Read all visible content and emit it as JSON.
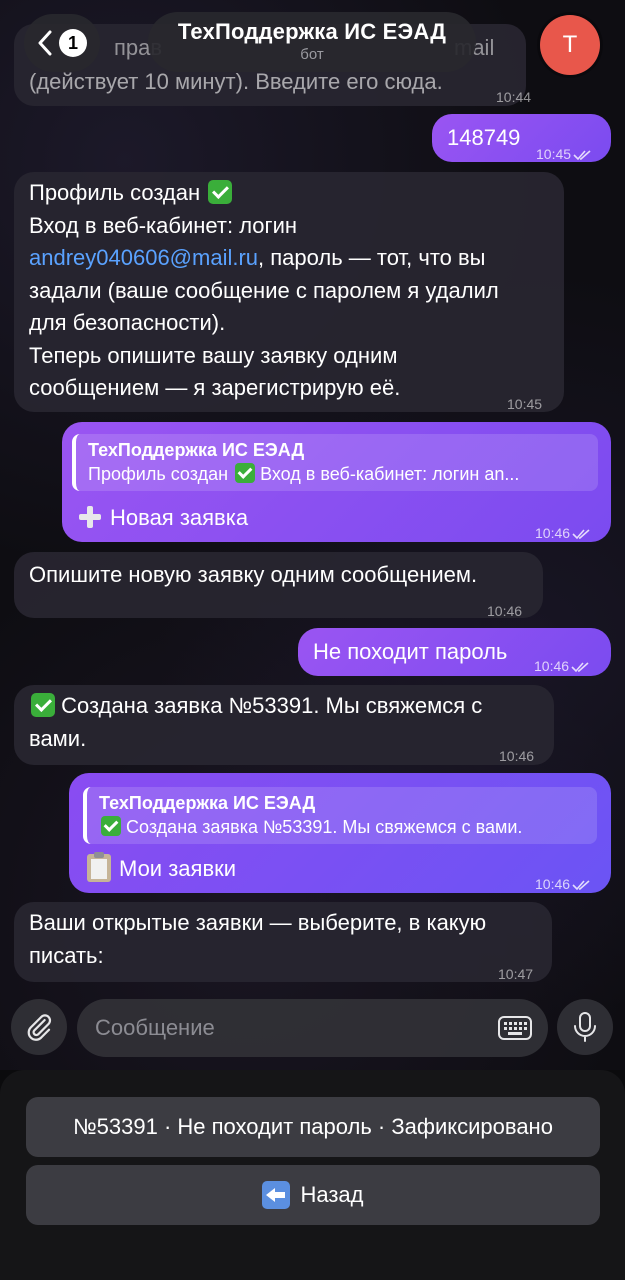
{
  "header": {
    "back_badge": "1",
    "title": "ТехПоддержка ИС ЕЭАД",
    "subtitle": "бот",
    "avatar_letter": "Т"
  },
  "messages": {
    "m0": {
      "partial_top_left": "прав",
      "partial_top_right": "mail",
      "text": "(действует 10 минут). Введите его сюда.",
      "time": "10:44"
    },
    "m1": {
      "text": "148749",
      "time": "10:45"
    },
    "m2": {
      "l1": "Профиль создан",
      "l2": "Вход в веб-кабинет: логин",
      "link": "andrey040606@mail.ru",
      "l3": ", пароль — тот, что вы",
      "l4": "задали (ваше сообщение с паролем я удалил",
      "l5": "для безопасности).",
      "l6": "Теперь опишите вашу заявку одним",
      "l7": "сообщением — я зарегистрирую её.",
      "time": "10:45"
    },
    "m3": {
      "quote_title": "ТехПоддержка ИС ЕЭАД",
      "quote_body": "Вход в веб-кабинет: логин an...",
      "quote_body_prefix": "Профиль создан",
      "text": "Новая заявка",
      "time": "10:46"
    },
    "m4": {
      "text": "Опишите новую заявку одним сообщением.",
      "time": "10:46"
    },
    "m5": {
      "text": "Не походит пароль",
      "time": "10:46"
    },
    "m6": {
      "l1": "Создана заявка №53391. Мы свяжемся с",
      "l2": "вами.",
      "time": "10:46"
    },
    "m7": {
      "quote_title": "ТехПоддержка ИС ЕЭАД",
      "quote_body": "Создана заявка №53391. Мы свяжемся с вами.",
      "text": "Мои заявки",
      "time": "10:46"
    },
    "m8": {
      "l1": "Ваши открытые заявки — выберите, в какую",
      "l2": "писать:",
      "time": "10:47"
    }
  },
  "composer": {
    "placeholder": "Сообщение"
  },
  "keyboard": {
    "btn1": "№53391 · Не походит пароль · Зафиксировано",
    "btn2": "Назад"
  },
  "icons": {
    "back": "chevron-left-icon",
    "attach": "paperclip-icon",
    "keyboard": "keyboard-icon",
    "mic": "microphone-icon",
    "check_emoji": "check-mark-emoji",
    "plus_emoji": "plus-emoji",
    "clipboard_emoji": "clipboard-emoji",
    "back_arrow_emoji": "left-arrow-emoji",
    "read_ticks": "double-check-icon"
  },
  "colors": {
    "outgoing": "#8a4ff2",
    "incoming": "#28262f",
    "link": "#5aa2ff",
    "avatar": "#e8574b"
  }
}
